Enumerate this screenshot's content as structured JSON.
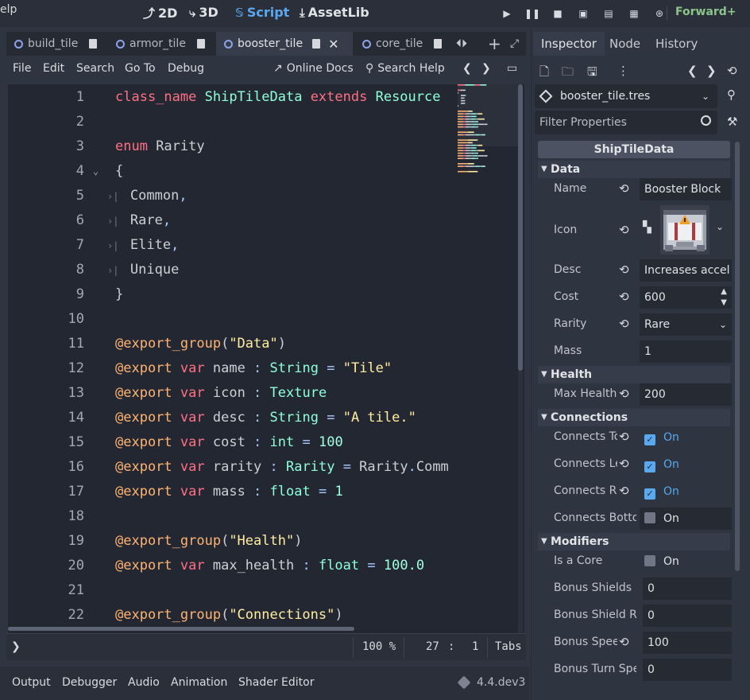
{
  "topbar": {
    "menu_fragment": "elp",
    "workspaces": [
      {
        "label": "2D",
        "icon": "scene-2d-icon"
      },
      {
        "label": "3D",
        "icon": "scene-3d-icon"
      },
      {
        "label": "Script",
        "icon": "script-icon",
        "active": true
      },
      {
        "label": "AssetLib",
        "icon": "assetlib-icon"
      }
    ],
    "renderer": "Forward+",
    "colors": {
      "accent": "#5aa8f0",
      "renderer": "#8cc48a"
    }
  },
  "script_tabs": [
    {
      "label": "build_tile",
      "active": false
    },
    {
      "label": "armor_tile",
      "active": false
    },
    {
      "label": "booster_tile",
      "active": true
    },
    {
      "label": "core_tile",
      "active": false
    }
  ],
  "script_menu": {
    "items": [
      "File",
      "Edit",
      "Search",
      "Go To",
      "Debug"
    ],
    "online_docs": "Online Docs",
    "search_help": "Search Help"
  },
  "code_lines": [
    {
      "n": "1",
      "seg": [
        [
          "kw",
          "class_name"
        ],
        [
          "pl",
          " "
        ],
        [
          "ty",
          "ShipTileData"
        ],
        [
          "pl",
          " "
        ],
        [
          "kw",
          "extends"
        ],
        [
          "pl",
          " "
        ],
        [
          "ty",
          "Resource"
        ]
      ]
    },
    {
      "n": "2",
      "seg": []
    },
    {
      "n": "3",
      "seg": [
        [
          "kw",
          "enum"
        ],
        [
          "pl",
          " Rarity"
        ]
      ]
    },
    {
      "n": "4",
      "fold": true,
      "seg": [
        [
          "pl",
          "{"
        ]
      ]
    },
    {
      "n": "5",
      "tab": true,
      "seg": [
        [
          "pl",
          "Common"
        ],
        [
          "sym",
          ","
        ]
      ]
    },
    {
      "n": "6",
      "tab": true,
      "seg": [
        [
          "pl",
          "Rare"
        ],
        [
          "sym",
          ","
        ]
      ]
    },
    {
      "n": "7",
      "tab": true,
      "seg": [
        [
          "pl",
          "Elite"
        ],
        [
          "sym",
          ","
        ]
      ]
    },
    {
      "n": "8",
      "tab": true,
      "seg": [
        [
          "pl",
          "Unique"
        ]
      ]
    },
    {
      "n": "9",
      "seg": [
        [
          "pl",
          "}"
        ]
      ]
    },
    {
      "n": "10",
      "seg": []
    },
    {
      "n": "11",
      "seg": [
        [
          "an",
          "@export_group"
        ],
        [
          "pl",
          "("
        ],
        [
          "st",
          "\"Data\""
        ],
        [
          "pl",
          ")"
        ]
      ]
    },
    {
      "n": "12",
      "seg": [
        [
          "an",
          "@export"
        ],
        [
          "pl",
          " "
        ],
        [
          "kw",
          "var"
        ],
        [
          "pl",
          " name "
        ],
        [
          "sym",
          ":"
        ],
        [
          "pl",
          " "
        ],
        [
          "ty",
          "String"
        ],
        [
          "pl",
          " "
        ],
        [
          "sym",
          "="
        ],
        [
          "pl",
          " "
        ],
        [
          "st",
          "\"Tile\""
        ]
      ]
    },
    {
      "n": "13",
      "seg": [
        [
          "an",
          "@export"
        ],
        [
          "pl",
          " "
        ],
        [
          "kw",
          "var"
        ],
        [
          "pl",
          " icon "
        ],
        [
          "sym",
          ":"
        ],
        [
          "pl",
          " "
        ],
        [
          "ty",
          "Texture"
        ]
      ]
    },
    {
      "n": "14",
      "seg": [
        [
          "an",
          "@export"
        ],
        [
          "pl",
          " "
        ],
        [
          "kw",
          "var"
        ],
        [
          "pl",
          " desc "
        ],
        [
          "sym",
          ":"
        ],
        [
          "pl",
          " "
        ],
        [
          "ty",
          "String"
        ],
        [
          "pl",
          " "
        ],
        [
          "sym",
          "="
        ],
        [
          "pl",
          " "
        ],
        [
          "st",
          "\"A tile.\""
        ]
      ]
    },
    {
      "n": "15",
      "seg": [
        [
          "an",
          "@export"
        ],
        [
          "pl",
          " "
        ],
        [
          "kw",
          "var"
        ],
        [
          "pl",
          " cost "
        ],
        [
          "sym",
          ":"
        ],
        [
          "pl",
          " "
        ],
        [
          "ty",
          "int"
        ],
        [
          "pl",
          " "
        ],
        [
          "sym",
          "="
        ],
        [
          "pl",
          " "
        ],
        [
          "nu",
          "100"
        ]
      ]
    },
    {
      "n": "16",
      "seg": [
        [
          "an",
          "@export"
        ],
        [
          "pl",
          " "
        ],
        [
          "kw",
          "var"
        ],
        [
          "pl",
          " rarity "
        ],
        [
          "sym",
          ":"
        ],
        [
          "pl",
          " "
        ],
        [
          "ty",
          "Rarity"
        ],
        [
          "pl",
          " "
        ],
        [
          "sym",
          "="
        ],
        [
          "pl",
          " Rarity"
        ],
        [
          "sym",
          "."
        ],
        [
          "pl",
          "Comm"
        ]
      ]
    },
    {
      "n": "17",
      "seg": [
        [
          "an",
          "@export"
        ],
        [
          "pl",
          " "
        ],
        [
          "kw",
          "var"
        ],
        [
          "pl",
          " mass "
        ],
        [
          "sym",
          ":"
        ],
        [
          "pl",
          " "
        ],
        [
          "ty",
          "float"
        ],
        [
          "pl",
          " "
        ],
        [
          "sym",
          "="
        ],
        [
          "pl",
          " "
        ],
        [
          "nu",
          "1"
        ]
      ]
    },
    {
      "n": "18",
      "seg": []
    },
    {
      "n": "19",
      "seg": [
        [
          "an",
          "@export_group"
        ],
        [
          "pl",
          "("
        ],
        [
          "st",
          "\"Health\""
        ],
        [
          "pl",
          ")"
        ]
      ]
    },
    {
      "n": "20",
      "seg": [
        [
          "an",
          "@export"
        ],
        [
          "pl",
          " "
        ],
        [
          "kw",
          "var"
        ],
        [
          "pl",
          " max_health "
        ],
        [
          "sym",
          ":"
        ],
        [
          "pl",
          " "
        ],
        [
          "ty",
          "float"
        ],
        [
          "pl",
          " "
        ],
        [
          "sym",
          "="
        ],
        [
          "pl",
          " "
        ],
        [
          "nu",
          "100.0"
        ]
      ]
    },
    {
      "n": "21",
      "seg": []
    },
    {
      "n": "22",
      "seg": [
        [
          "an",
          "@export_group"
        ],
        [
          "pl",
          "("
        ],
        [
          "st",
          "\"Connections\""
        ],
        [
          "pl",
          ")"
        ]
      ]
    }
  ],
  "syntax_colors": {
    "kw": "#ff7085",
    "ty": "#8effda",
    "an": "#ffb373",
    "st": "#ffeda1",
    "nu": "#a1ffe0",
    "pl": "#cdcfd4",
    "sym": "#abc9ff"
  },
  "statusbar": {
    "prompt": "❯",
    "zoom": "100 %",
    "line": "27",
    "col": "1",
    "indent": "Tabs"
  },
  "bottombar": {
    "tabs": [
      "Output",
      "Debugger",
      "Audio",
      "Animation",
      "Shader Editor"
    ],
    "version": "4.4.dev3"
  },
  "inspector": {
    "tabs": [
      "Inspector",
      "Node",
      "History"
    ],
    "resource": "booster_tile.tres",
    "filter_placeholder": "Filter Properties",
    "class_name": "ShipTileData",
    "sections": {
      "data": "Data",
      "health": "Health",
      "connections": "Connections",
      "modifiers": "Modifiers"
    },
    "props": {
      "name": {
        "label": "Name",
        "value": "Booster Block"
      },
      "icon": {
        "label": "Icon"
      },
      "desc": {
        "label": "Desc",
        "value": "Increases accel"
      },
      "cost": {
        "label": "Cost",
        "value": "600"
      },
      "rarity": {
        "label": "Rarity",
        "value": "Rare"
      },
      "mass": {
        "label": "Mass",
        "value": "1"
      },
      "max_health": {
        "label": "Max Health",
        "value": "200"
      },
      "connects_top": {
        "label": "Connects To",
        "value": "On",
        "checked": true
      },
      "connects_left": {
        "label": "Connects Le",
        "value": "On",
        "checked": true
      },
      "connects_right": {
        "label": "Connects Ri",
        "value": "On",
        "checked": true
      },
      "connects_bottom": {
        "label": "Connects Botto",
        "value": "On",
        "checked": false
      },
      "is_core": {
        "label": "Is a Core",
        "value": "On",
        "checked": false
      },
      "bonus_shields": {
        "label": "Bonus Shields",
        "value": "0"
      },
      "bonus_shield_r": {
        "label": "Bonus Shield R",
        "value": "0"
      },
      "bonus_speed": {
        "label": "Bonus Spee",
        "value": "100"
      },
      "bonus_turn": {
        "label": "Bonus Turn Spe",
        "value": "0"
      }
    }
  }
}
